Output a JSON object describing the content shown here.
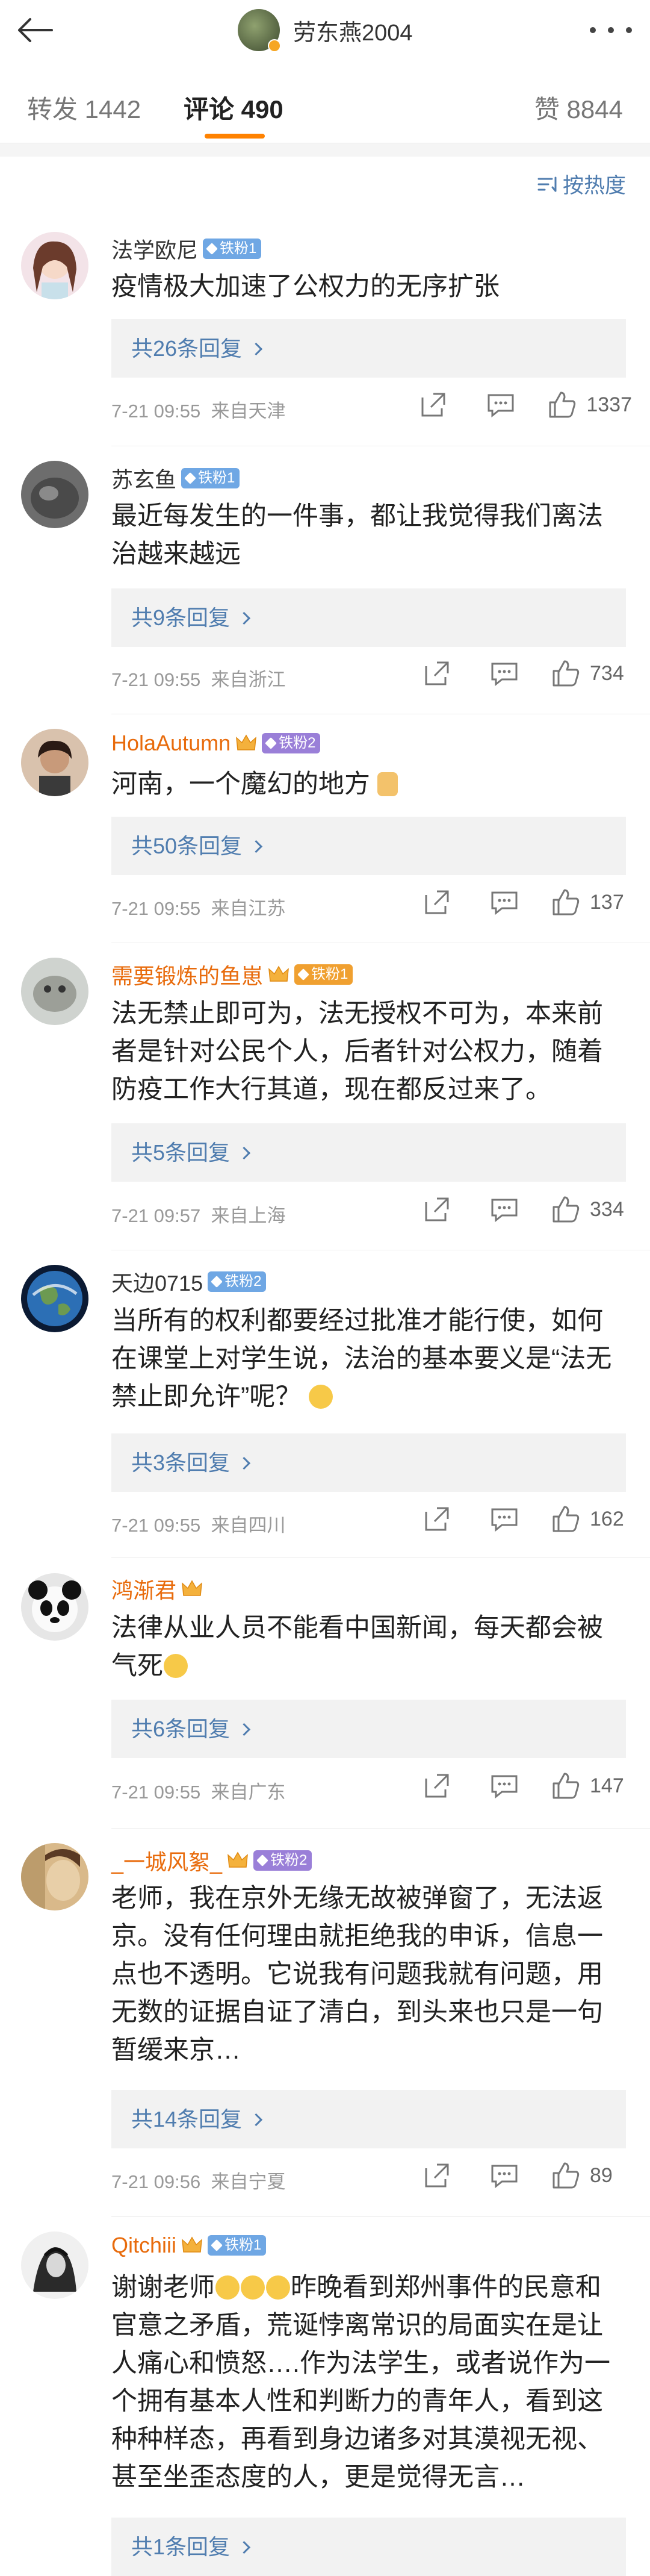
{
  "header": {
    "profile_name": "劳东燕2004",
    "back_icon": "back-arrow-icon",
    "more_icon": "more-dots-icon"
  },
  "tabs": {
    "repost": "转发 1442",
    "comment": "评论 490",
    "like": "赞 8844"
  },
  "sort": {
    "label": "按热度"
  },
  "accent_color": "#ff8200",
  "link_color": "#507daf",
  "comments": [
    {
      "name": "法学欧尼",
      "badge": "铁粉1",
      "text": "疫情极大加速了公权力的无序扩张",
      "replies": "共26条回复",
      "time": "7-21 09:55",
      "location": "来自天津",
      "likes": "1337"
    },
    {
      "name": "苏玄鱼",
      "badge": "铁粉1",
      "text": "最近每发生的一件事，都让我觉得我们离法治越来越远",
      "replies": "共9条回复",
      "time": "7-21 09:55",
      "location": "来自浙江",
      "likes": "734"
    },
    {
      "name": "HolaAutumn",
      "badge": "铁粉2",
      "text": "河南，一个魔幻的地方",
      "replies": "共50条回复",
      "time": "7-21 09:55",
      "location": "来自江苏",
      "likes": "137"
    },
    {
      "name": "需要锻炼的鱼崽",
      "badge": "铁粉1",
      "text": "法无禁止即可为，法无授权不可为，本来前者是针对公民个人，后者针对公权力，随着防疫工作大行其道，现在都反过来了。",
      "replies": "共5条回复",
      "time": "7-21 09:57",
      "location": "来自上海",
      "likes": "334"
    },
    {
      "name": "天边0715",
      "badge": "铁粉2",
      "text": "当所有的权利都要经过批准才能行使，如何在课堂上对学生说，法治的基本要义是“法无禁止即允许”呢？",
      "replies": "共3条回复",
      "time": "7-21 09:55",
      "location": "来自四川",
      "likes": "162"
    },
    {
      "name": "鸿渐君",
      "badge": "",
      "text": "法律从业人员不能看中国新闻，每天都会被气死",
      "replies": "共6条回复",
      "time": "7-21 09:55",
      "location": "来自广东",
      "likes": "147"
    },
    {
      "name": "_一城风絮_",
      "badge": "铁粉2",
      "text": "老师，我在京外无缘无故被弹窗了，无法返京。没有任何理由就拒绝我的申诉，信息一点也不透明。它说我有问题我就有问题，用无数的证据自证了清白，到头来也只是一句暂缓来京…",
      "replies": "共14条回复",
      "time": "7-21 09:56",
      "location": "来自宁夏",
      "likes": "89"
    },
    {
      "name": "Qitchiii",
      "badge": "铁粉1",
      "text_a": "谢谢老师",
      "text_b": "昨晚看到郑州事件的民意和官意之矛盾，荒诞悖离常识的局面实在是让人痛心和愤怒….作为法学生，或者说作为一个拥有基本人性和判断力的青年人，看到这种种样态，再看到身边诸多对其漠视无视、甚至坐歪态度的人，更是觉得无言…",
      "replies": "共1条回复"
    }
  ]
}
